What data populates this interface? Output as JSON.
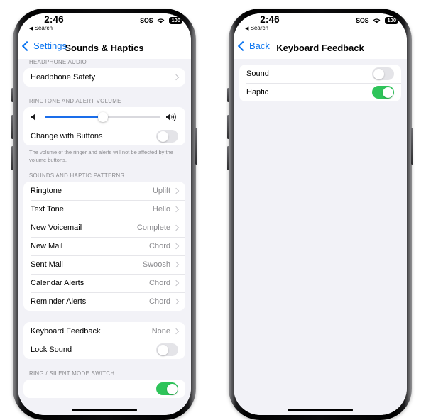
{
  "status_bar": {
    "time": "2:46",
    "search_label": "Search",
    "search_arrow": "◀",
    "sos_label": "SOS",
    "sos_dots": "....",
    "wifi_icon": "wifi-icon",
    "battery_level": "100"
  },
  "phone_left": {
    "nav": {
      "back_label": "Settings",
      "title": "Sounds & Haptics"
    },
    "sections": [
      {
        "header": "HEADPHONE AUDIO",
        "rows": [
          {
            "label": "Headphone Safety",
            "value": "",
            "type": "disclosure"
          }
        ],
        "footer": ""
      },
      {
        "header": "RINGTONE AND ALERT VOLUME",
        "rows": [
          {
            "label": "",
            "type": "slider",
            "volume_percent": 50,
            "left_icon": "speaker-low-icon",
            "right_icon": "speaker-high-icon"
          },
          {
            "label": "Change with Buttons",
            "type": "toggle",
            "on": false
          }
        ],
        "footer": "The volume of the ringer and alerts will not be affected by the volume buttons."
      },
      {
        "header": "SOUNDS AND HAPTIC PATTERNS",
        "rows": [
          {
            "label": "Ringtone",
            "value": "Uplift",
            "type": "disclosure"
          },
          {
            "label": "Text Tone",
            "value": "Hello",
            "type": "disclosure"
          },
          {
            "label": "New Voicemail",
            "value": "Complete",
            "type": "disclosure"
          },
          {
            "label": "New Mail",
            "value": "Chord",
            "type": "disclosure"
          },
          {
            "label": "Sent Mail",
            "value": "Swoosh",
            "type": "disclosure"
          },
          {
            "label": "Calendar Alerts",
            "value": "Chord",
            "type": "disclosure"
          },
          {
            "label": "Reminder Alerts",
            "value": "Chord",
            "type": "disclosure"
          }
        ],
        "footer": ""
      },
      {
        "header": "",
        "rows": [
          {
            "label": "Keyboard Feedback",
            "value": "None",
            "type": "disclosure"
          },
          {
            "label": "Lock Sound",
            "type": "toggle",
            "on": false
          }
        ],
        "footer": ""
      },
      {
        "header": "RING / SILENT MODE SWITCH",
        "rows": [],
        "footer": ""
      }
    ]
  },
  "phone_right": {
    "nav": {
      "back_label": "Back",
      "title": "Keyboard Feedback"
    },
    "rows": [
      {
        "label": "Sound",
        "type": "toggle",
        "on": false
      },
      {
        "label": "Haptic",
        "type": "toggle",
        "on": true
      }
    ]
  },
  "colors": {
    "accent_blue": "#0a74f0",
    "slider_blue": "#1a6dea",
    "toggle_green": "#2fc45a",
    "toggle_off": "#e4e4e8",
    "background": "#f2f2f7",
    "card": "#ffffff",
    "secondary_text": "#8a8a8e"
  }
}
